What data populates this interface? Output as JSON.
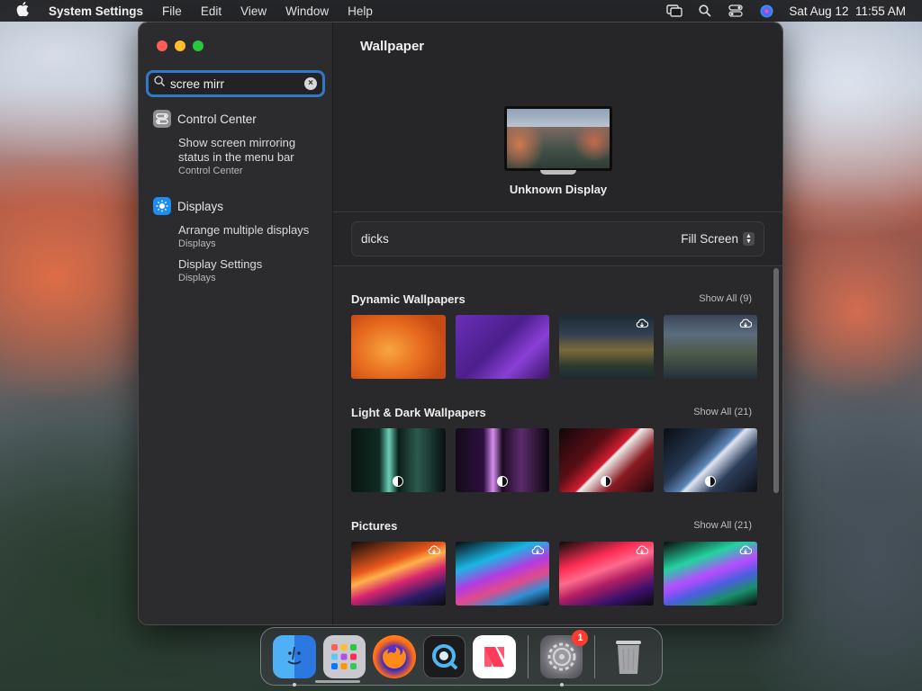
{
  "menubar": {
    "app_name": "System Settings",
    "menus": [
      "File",
      "Edit",
      "View",
      "Window",
      "Help"
    ],
    "datetime": "Sat Aug 12  11:55 AM"
  },
  "sidebar": {
    "search_value": "scree mirr",
    "results": [
      {
        "label": "Control Center",
        "icon": "control-center-icon",
        "items": [
          {
            "title": "Show screen mirroring status in the menu bar",
            "subtitle": "Control Center"
          }
        ]
      },
      {
        "label": "Displays",
        "icon": "displays-icon",
        "items": [
          {
            "title": "Arrange multiple displays",
            "subtitle": "Displays"
          },
          {
            "title": "Display Settings",
            "subtitle": "Displays"
          }
        ]
      }
    ]
  },
  "main": {
    "title": "Wallpaper",
    "display_name": "Unknown Display",
    "wallpaper_name": "dicks",
    "fill_mode": "Fill Screen",
    "sections": [
      {
        "title": "Dynamic Wallpapers",
        "show_all": "Show All (9)"
      },
      {
        "title": "Light & Dark Wallpapers",
        "show_all": "Show All (21)"
      },
      {
        "title": "Pictures",
        "show_all": "Show All (21)"
      }
    ]
  },
  "dock": {
    "apps": [
      "Finder",
      "Launchpad",
      "Firefox",
      "QuickTime Player",
      "News",
      "System Settings",
      "Trash"
    ],
    "settings_badge": "1"
  },
  "colors": {
    "accent": "#2f79c8",
    "badge": "#ff3b30"
  }
}
